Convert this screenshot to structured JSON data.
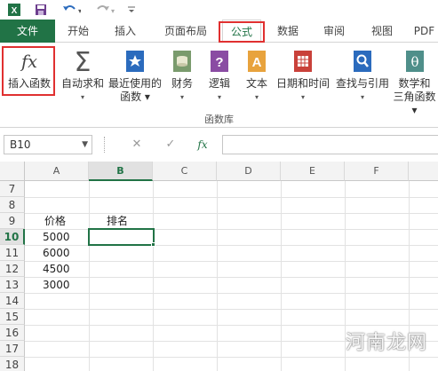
{
  "qat": {
    "save_icon": "save-icon",
    "undo_icon": "undo-icon",
    "redo_icon": "redo-icon",
    "customize_icon": "customize-icon"
  },
  "tabs": {
    "file": "文件",
    "items": [
      "开始",
      "插入",
      "页面布局",
      "公式",
      "数据",
      "审阅",
      "视图",
      "PDF"
    ],
    "active": "公式"
  },
  "ribbon": {
    "buttons": [
      {
        "line1": "插入函数",
        "line2": "",
        "icon": "fx-icon"
      },
      {
        "line1": "自动求和",
        "line2": "▾",
        "icon": "sigma-icon"
      },
      {
        "line1": "最近使用的",
        "line2": "函数 ▾",
        "icon": "star-book-icon"
      },
      {
        "line1": "财务",
        "line2": "▾",
        "icon": "finance-book-icon"
      },
      {
        "line1": "逻辑",
        "line2": "▾",
        "icon": "logic-book-icon"
      },
      {
        "line1": "文本",
        "line2": "▾",
        "icon": "text-book-icon"
      },
      {
        "line1": "日期和时间",
        "line2": "▾",
        "icon": "calendar-book-icon"
      },
      {
        "line1": "查找与引用",
        "line2": "▾",
        "icon": "lookup-book-icon"
      },
      {
        "line1": "数学和",
        "line2": "三角函数 ▾",
        "icon": "math-book-icon"
      }
    ],
    "group_label": "函数库"
  },
  "formula_bar": {
    "name_box": "B10",
    "cancel_symbol": "✕",
    "enter_symbol": "✓",
    "fx_symbol": "fx",
    "formula": ""
  },
  "sheet": {
    "columns": [
      "A",
      "B",
      "C",
      "D",
      "E",
      "F"
    ],
    "selected_column": "B",
    "rows": [
      7,
      8,
      9,
      10,
      11,
      12,
      13,
      14,
      15,
      16,
      17,
      18
    ],
    "selected_row": 10,
    "cells": {
      "A9": "价格",
      "B9": "排名",
      "A10": "5000",
      "A11": "6000",
      "A12": "4500",
      "A13": "3000"
    }
  },
  "watermark": "河南龙网",
  "colors": {
    "accent": "#217346",
    "highlight": "#e03030"
  }
}
